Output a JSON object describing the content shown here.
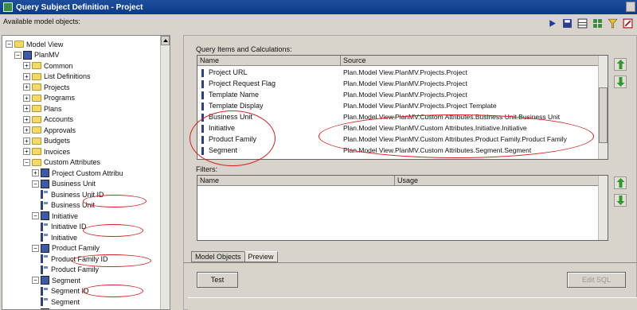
{
  "window": {
    "title": "Query Subject Definition - Project"
  },
  "left": {
    "label": "Available model objects:",
    "tree": [
      {
        "label": "Model View",
        "level": 0,
        "type": "folder",
        "expanded": true
      },
      {
        "label": "PlanMV",
        "level": 1,
        "type": "db",
        "expanded": true
      },
      {
        "label": "Common",
        "level": 2,
        "type": "folder",
        "expanded": false
      },
      {
        "label": "List Definitions",
        "level": 2,
        "type": "folder",
        "expanded": false
      },
      {
        "label": "Projects",
        "level": 2,
        "type": "folder",
        "expanded": false
      },
      {
        "label": "Programs",
        "level": 2,
        "type": "folder",
        "expanded": false
      },
      {
        "label": "Plans",
        "level": 2,
        "type": "folder",
        "expanded": false
      },
      {
        "label": "Accounts",
        "level": 2,
        "type": "folder",
        "expanded": false
      },
      {
        "label": "Approvals",
        "level": 2,
        "type": "folder",
        "expanded": false
      },
      {
        "label": "Budgets",
        "level": 2,
        "type": "folder",
        "expanded": false
      },
      {
        "label": "Invoices",
        "level": 2,
        "type": "folder",
        "expanded": false
      },
      {
        "label": "Custom Attributes",
        "level": 2,
        "type": "folder",
        "expanded": true
      },
      {
        "label": "Project Custom Attribu",
        "level": 3,
        "type": "db",
        "expanded": false
      },
      {
        "label": "Business Unit",
        "level": 3,
        "type": "db",
        "expanded": true
      },
      {
        "label": "Business Unit ID",
        "level": 4,
        "type": "item"
      },
      {
        "label": "Business Unit",
        "level": 4,
        "type": "item"
      },
      {
        "label": "Initiative",
        "level": 3,
        "type": "db",
        "expanded": true
      },
      {
        "label": "Initiative ID",
        "level": 4,
        "type": "item"
      },
      {
        "label": "Initiative",
        "level": 4,
        "type": "item"
      },
      {
        "label": "Product Family",
        "level": 3,
        "type": "db",
        "expanded": true
      },
      {
        "label": "Product Family ID",
        "level": 4,
        "type": "item"
      },
      {
        "label": "Product Family",
        "level": 4,
        "type": "item"
      },
      {
        "label": "Segment",
        "level": 3,
        "type": "db",
        "expanded": true
      },
      {
        "label": "Segment ID",
        "level": 4,
        "type": "item"
      },
      {
        "label": "Segment",
        "level": 4,
        "type": "item"
      },
      {
        "label": "Project Performance S",
        "level": 3,
        "type": "db",
        "expanded": false
      }
    ]
  },
  "query": {
    "label": "Query Items and Calculations:",
    "columns": [
      "Name",
      "Source"
    ],
    "rows": [
      {
        "name": "Project URL",
        "source": "Plan.Model View.PlanMV.Projects.Project"
      },
      {
        "name": "Project Request Flag",
        "source": "Plan.Model View.PlanMV.Projects.Project"
      },
      {
        "name": "Template Name",
        "source": "Plan.Model View.PlanMV.Projects.Project"
      },
      {
        "name": "Template Display",
        "source": "Plan.Model View.PlanMV.Projects.Project Template"
      },
      {
        "name": "Business Unit",
        "source": "Plan.Model View.PlanMV.Custom Attributes.Business Unit.Business Unit"
      },
      {
        "name": "Initiative",
        "source": "Plan.Model View.PlanMV.Custom Attributes.Initiative.Initiative"
      },
      {
        "name": "Product Family",
        "source": "Plan.Model View.PlanMV.Custom Attributes.Product Family.Product Family"
      },
      {
        "name": "Segment",
        "source": "Plan.Model View.PlanMV.Custom Attributes.Segment.Segment"
      }
    ]
  },
  "filters": {
    "label": "Filters:",
    "columns": [
      "Name",
      "Usage"
    ]
  },
  "tabs": [
    "Model Objects",
    "Preview"
  ],
  "buttons": {
    "test": "Test",
    "edit_sql": "Edit SQL"
  },
  "colors": {
    "titlebar": "#0a3a8a",
    "highlight_ellipse": "#d92020",
    "panel": "#d8d4cc"
  }
}
